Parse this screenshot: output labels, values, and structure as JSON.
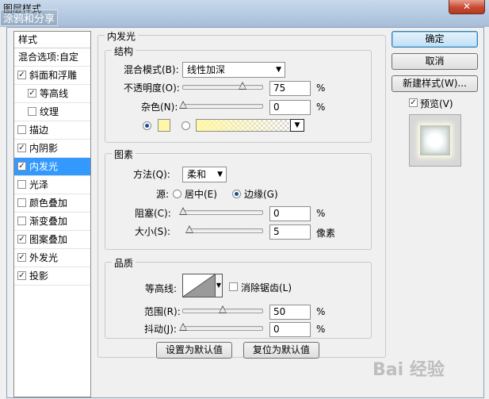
{
  "window": {
    "title": "图层样式",
    "overlay_text": "涂鸦和分享",
    "close_label": "✕"
  },
  "style_list": {
    "header": "样式",
    "items": [
      {
        "label": "混合选项:自定",
        "checkbox": false,
        "checked": false,
        "sub": false,
        "selected": false
      },
      {
        "label": "斜面和浮雕",
        "checkbox": true,
        "checked": true,
        "sub": false,
        "selected": false
      },
      {
        "label": "等高线",
        "checkbox": true,
        "checked": true,
        "sub": true,
        "selected": false
      },
      {
        "label": "纹理",
        "checkbox": true,
        "checked": false,
        "sub": true,
        "selected": false
      },
      {
        "label": "描边",
        "checkbox": true,
        "checked": false,
        "sub": false,
        "selected": false
      },
      {
        "label": "内阴影",
        "checkbox": true,
        "checked": true,
        "sub": false,
        "selected": false
      },
      {
        "label": "内发光",
        "checkbox": true,
        "checked": true,
        "sub": false,
        "selected": true
      },
      {
        "label": "光泽",
        "checkbox": true,
        "checked": false,
        "sub": false,
        "selected": false
      },
      {
        "label": "颜色叠加",
        "checkbox": true,
        "checked": false,
        "sub": false,
        "selected": false
      },
      {
        "label": "渐变叠加",
        "checkbox": true,
        "checked": false,
        "sub": false,
        "selected": false
      },
      {
        "label": "图案叠加",
        "checkbox": true,
        "checked": true,
        "sub": false,
        "selected": false
      },
      {
        "label": "外发光",
        "checkbox": true,
        "checked": true,
        "sub": false,
        "selected": false
      },
      {
        "label": "投影",
        "checkbox": true,
        "checked": true,
        "sub": false,
        "selected": false
      }
    ]
  },
  "panel": {
    "title": "内发光",
    "structure": {
      "title": "结构",
      "blend_mode_label": "混合模式(B):",
      "blend_mode_value": "线性加深",
      "opacity_label": "不透明度(O):",
      "opacity_value": "75",
      "opacity_percent": 75,
      "noise_label": "杂色(N):",
      "noise_value": "0",
      "noise_percent": 0,
      "percent_unit": "%",
      "color_swatch": "#fff6a8"
    },
    "elements": {
      "title": "图素",
      "method_label": "方法(Q):",
      "method_value": "柔和",
      "source_label": "源:",
      "source_center": "居中(E)",
      "source_edge": "边缘(G)",
      "choke_label": "阻塞(C):",
      "choke_value": "0",
      "choke_percent": 0,
      "size_label": "大小(S):",
      "size_value": "5",
      "size_fraction": 0.02,
      "size_unit": "像素",
      "percent_unit": "%"
    },
    "quality": {
      "title": "品质",
      "contour_label": "等高线:",
      "anti_alias_label": "消除锯齿(L)",
      "range_label": "范围(R):",
      "range_value": "50",
      "range_percent": 50,
      "jitter_label": "抖动(J):",
      "jitter_value": "0",
      "jitter_percent": 0,
      "percent_unit": "%"
    },
    "make_default": "设置为默认值",
    "reset_default": "复位为默认值"
  },
  "buttons": {
    "ok": "确定",
    "cancel": "取消",
    "new_style": "新建样式(W)...",
    "preview_label": "预览(V)"
  },
  "watermark": "Bai 经验"
}
